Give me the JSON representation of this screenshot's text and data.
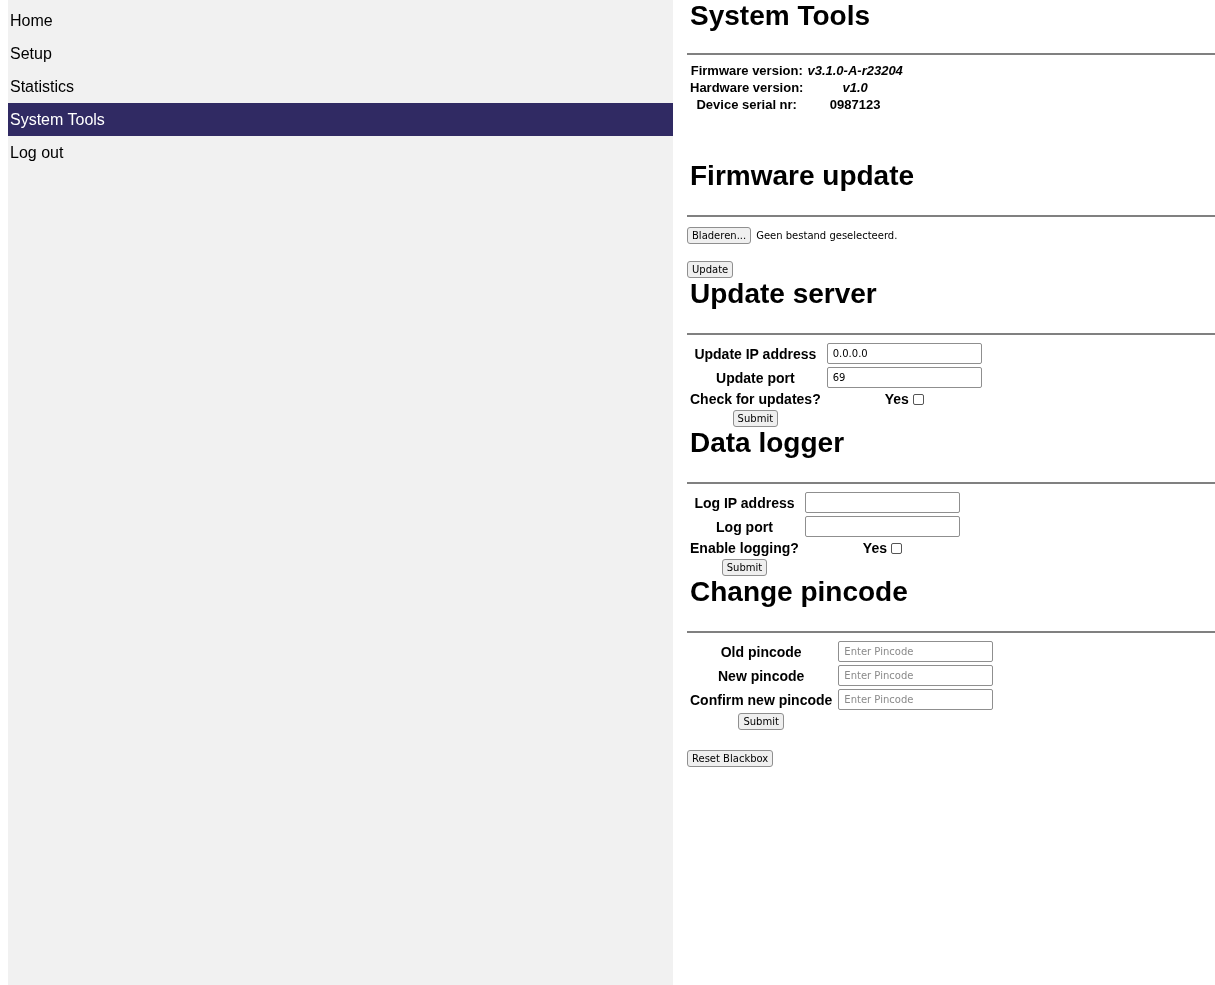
{
  "sidebar": {
    "items": [
      {
        "label": "Home",
        "selected": false
      },
      {
        "label": "Setup",
        "selected": false
      },
      {
        "label": "Statistics",
        "selected": false
      },
      {
        "label": "System Tools",
        "selected": true
      },
      {
        "label": "Log out",
        "selected": false
      }
    ]
  },
  "sections": [
    {
      "kind": "info",
      "title": "System Tools",
      "rows": [
        {
          "label": "Firmware version:",
          "value": "v3.1.0-A-r23204",
          "italic": true
        },
        {
          "label": "Hardware version:",
          "value": "v1.0",
          "italic": true
        },
        {
          "label": "Device serial nr:",
          "value": "0987123",
          "italic": false
        }
      ]
    },
    {
      "kind": "upload",
      "title": "Firmware update",
      "browse_button": "Bladeren...",
      "file_status": "Geen bestand geselecteerd.",
      "button": "Update"
    },
    {
      "kind": "form",
      "title": "Update server",
      "rows": [
        {
          "kind": "text",
          "label": "Update IP address",
          "value": "0.0.0.0"
        },
        {
          "kind": "text",
          "label": "Update port",
          "value": "69"
        },
        {
          "kind": "checkbox",
          "label": "Check for updates?",
          "option": "Yes",
          "checked": false
        }
      ],
      "button": "Submit"
    },
    {
      "kind": "form",
      "title": "Data logger",
      "rows": [
        {
          "kind": "text",
          "label": "Log IP address",
          "value": ""
        },
        {
          "kind": "text",
          "label": "Log port",
          "value": ""
        },
        {
          "kind": "checkbox",
          "label": "Enable logging?",
          "option": "Yes",
          "checked": false
        }
      ],
      "button": "Submit"
    },
    {
      "kind": "form",
      "title": "Change pincode",
      "rows": [
        {
          "kind": "text",
          "label": "Old pincode",
          "placeholder": "Enter Pincode"
        },
        {
          "kind": "text",
          "label": "New pincode",
          "placeholder": "Enter Pincode"
        },
        {
          "kind": "text",
          "label": "Confirm new pincode",
          "placeholder": "Enter Pincode"
        }
      ],
      "button": "Submit"
    }
  ],
  "reset_button": "Reset Blackbox"
}
